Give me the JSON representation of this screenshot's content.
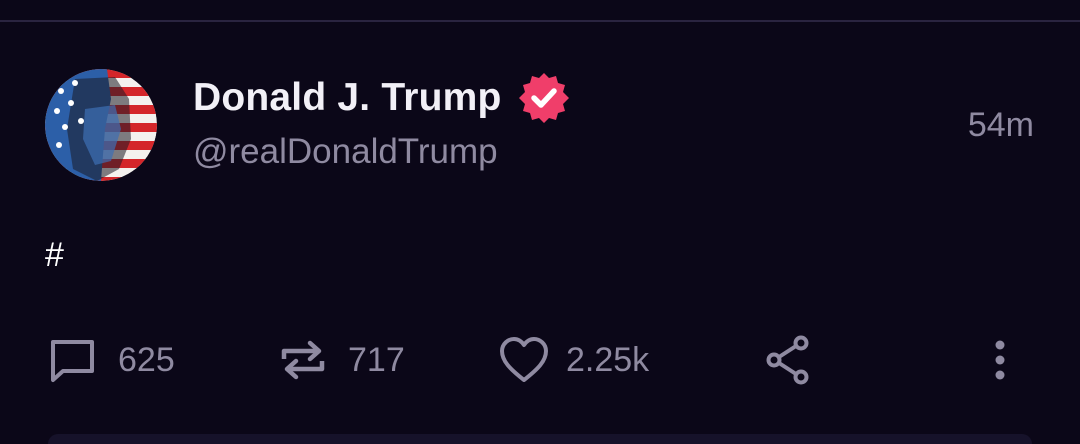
{
  "post": {
    "author_name": "Donald J. Trump",
    "author_handle": "@realDonaldTrump",
    "verified": true,
    "time_ago": "54m",
    "text": "#",
    "avatar_icon": "profile-avatar-flag-portrait"
  },
  "actions": {
    "replies": "625",
    "reposts": "717",
    "likes": "2.25k"
  },
  "colors": {
    "background": "#0b0718",
    "text_primary": "#f2f0f7",
    "text_secondary": "#8f8aa1",
    "verified_badge": "#f03e6a"
  }
}
